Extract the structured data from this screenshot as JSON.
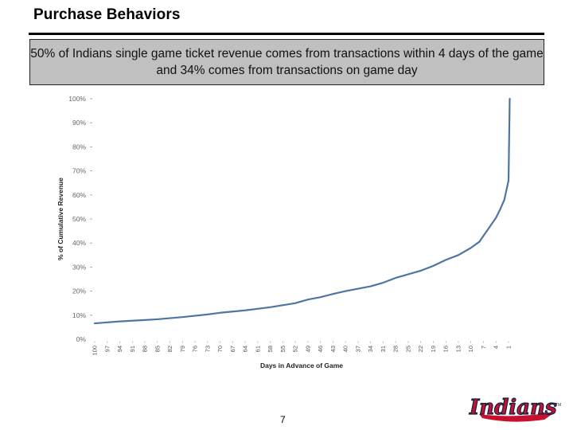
{
  "slide": {
    "title": "Purchase Behaviors",
    "callout": "50% of Indians single game ticket revenue comes from transactions within 4 days of the game and 34% comes from transactions on game day",
    "page_number": "7",
    "logo_text": "Indians",
    "logo_tm": "TM"
  },
  "colors": {
    "line": "#4f75a3",
    "callout_bg": "#c0c0c0",
    "logo_red": "#c8102e",
    "logo_navy": "#0c2340"
  },
  "chart_data": {
    "type": "line",
    "title": "",
    "xlabel": "Days in Advance of Game",
    "ylabel": "% of Cumulative Revenue",
    "ylim": [
      0,
      100
    ],
    "y_ticks": [
      "0%",
      "10%",
      "20%",
      "30%",
      "40%",
      "50%",
      "60%",
      "70%",
      "80%",
      "90%",
      "100%"
    ],
    "x_tick_labels": [
      "100",
      "97",
      "94",
      "91",
      "88",
      "85",
      "82",
      "79",
      "76",
      "73",
      "70",
      "67",
      "64",
      "61",
      "58",
      "55",
      "52",
      "49",
      "46",
      "43",
      "40",
      "37",
      "34",
      "31",
      "28",
      "25",
      "22",
      "19",
      "16",
      "13",
      "10",
      "7",
      "4",
      "1"
    ],
    "x_direction": "descending",
    "grid": false,
    "legend": "none",
    "series": [
      {
        "name": "% of Cumulative Revenue",
        "x": [
          100,
          94,
          88,
          85,
          79,
          73,
          70,
          64,
          58,
          52,
          49,
          46,
          43,
          40,
          34,
          31,
          28,
          25,
          22,
          19,
          16,
          13,
          10,
          8,
          7,
          6,
          5,
          4,
          3,
          2,
          1,
          0
        ],
        "y": [
          6.6,
          7.4,
          8.0,
          8.3,
          9.2,
          10.3,
          11.0,
          12.0,
          13.3,
          15.0,
          16.5,
          17.5,
          18.8,
          20.0,
          22.0,
          23.5,
          25.5,
          27.0,
          28.5,
          30.5,
          33.0,
          35.0,
          38.0,
          40.5,
          43.0,
          45.5,
          48.0,
          50.5,
          54.0,
          58.0,
          66.0,
          100.0
        ]
      }
    ]
  }
}
